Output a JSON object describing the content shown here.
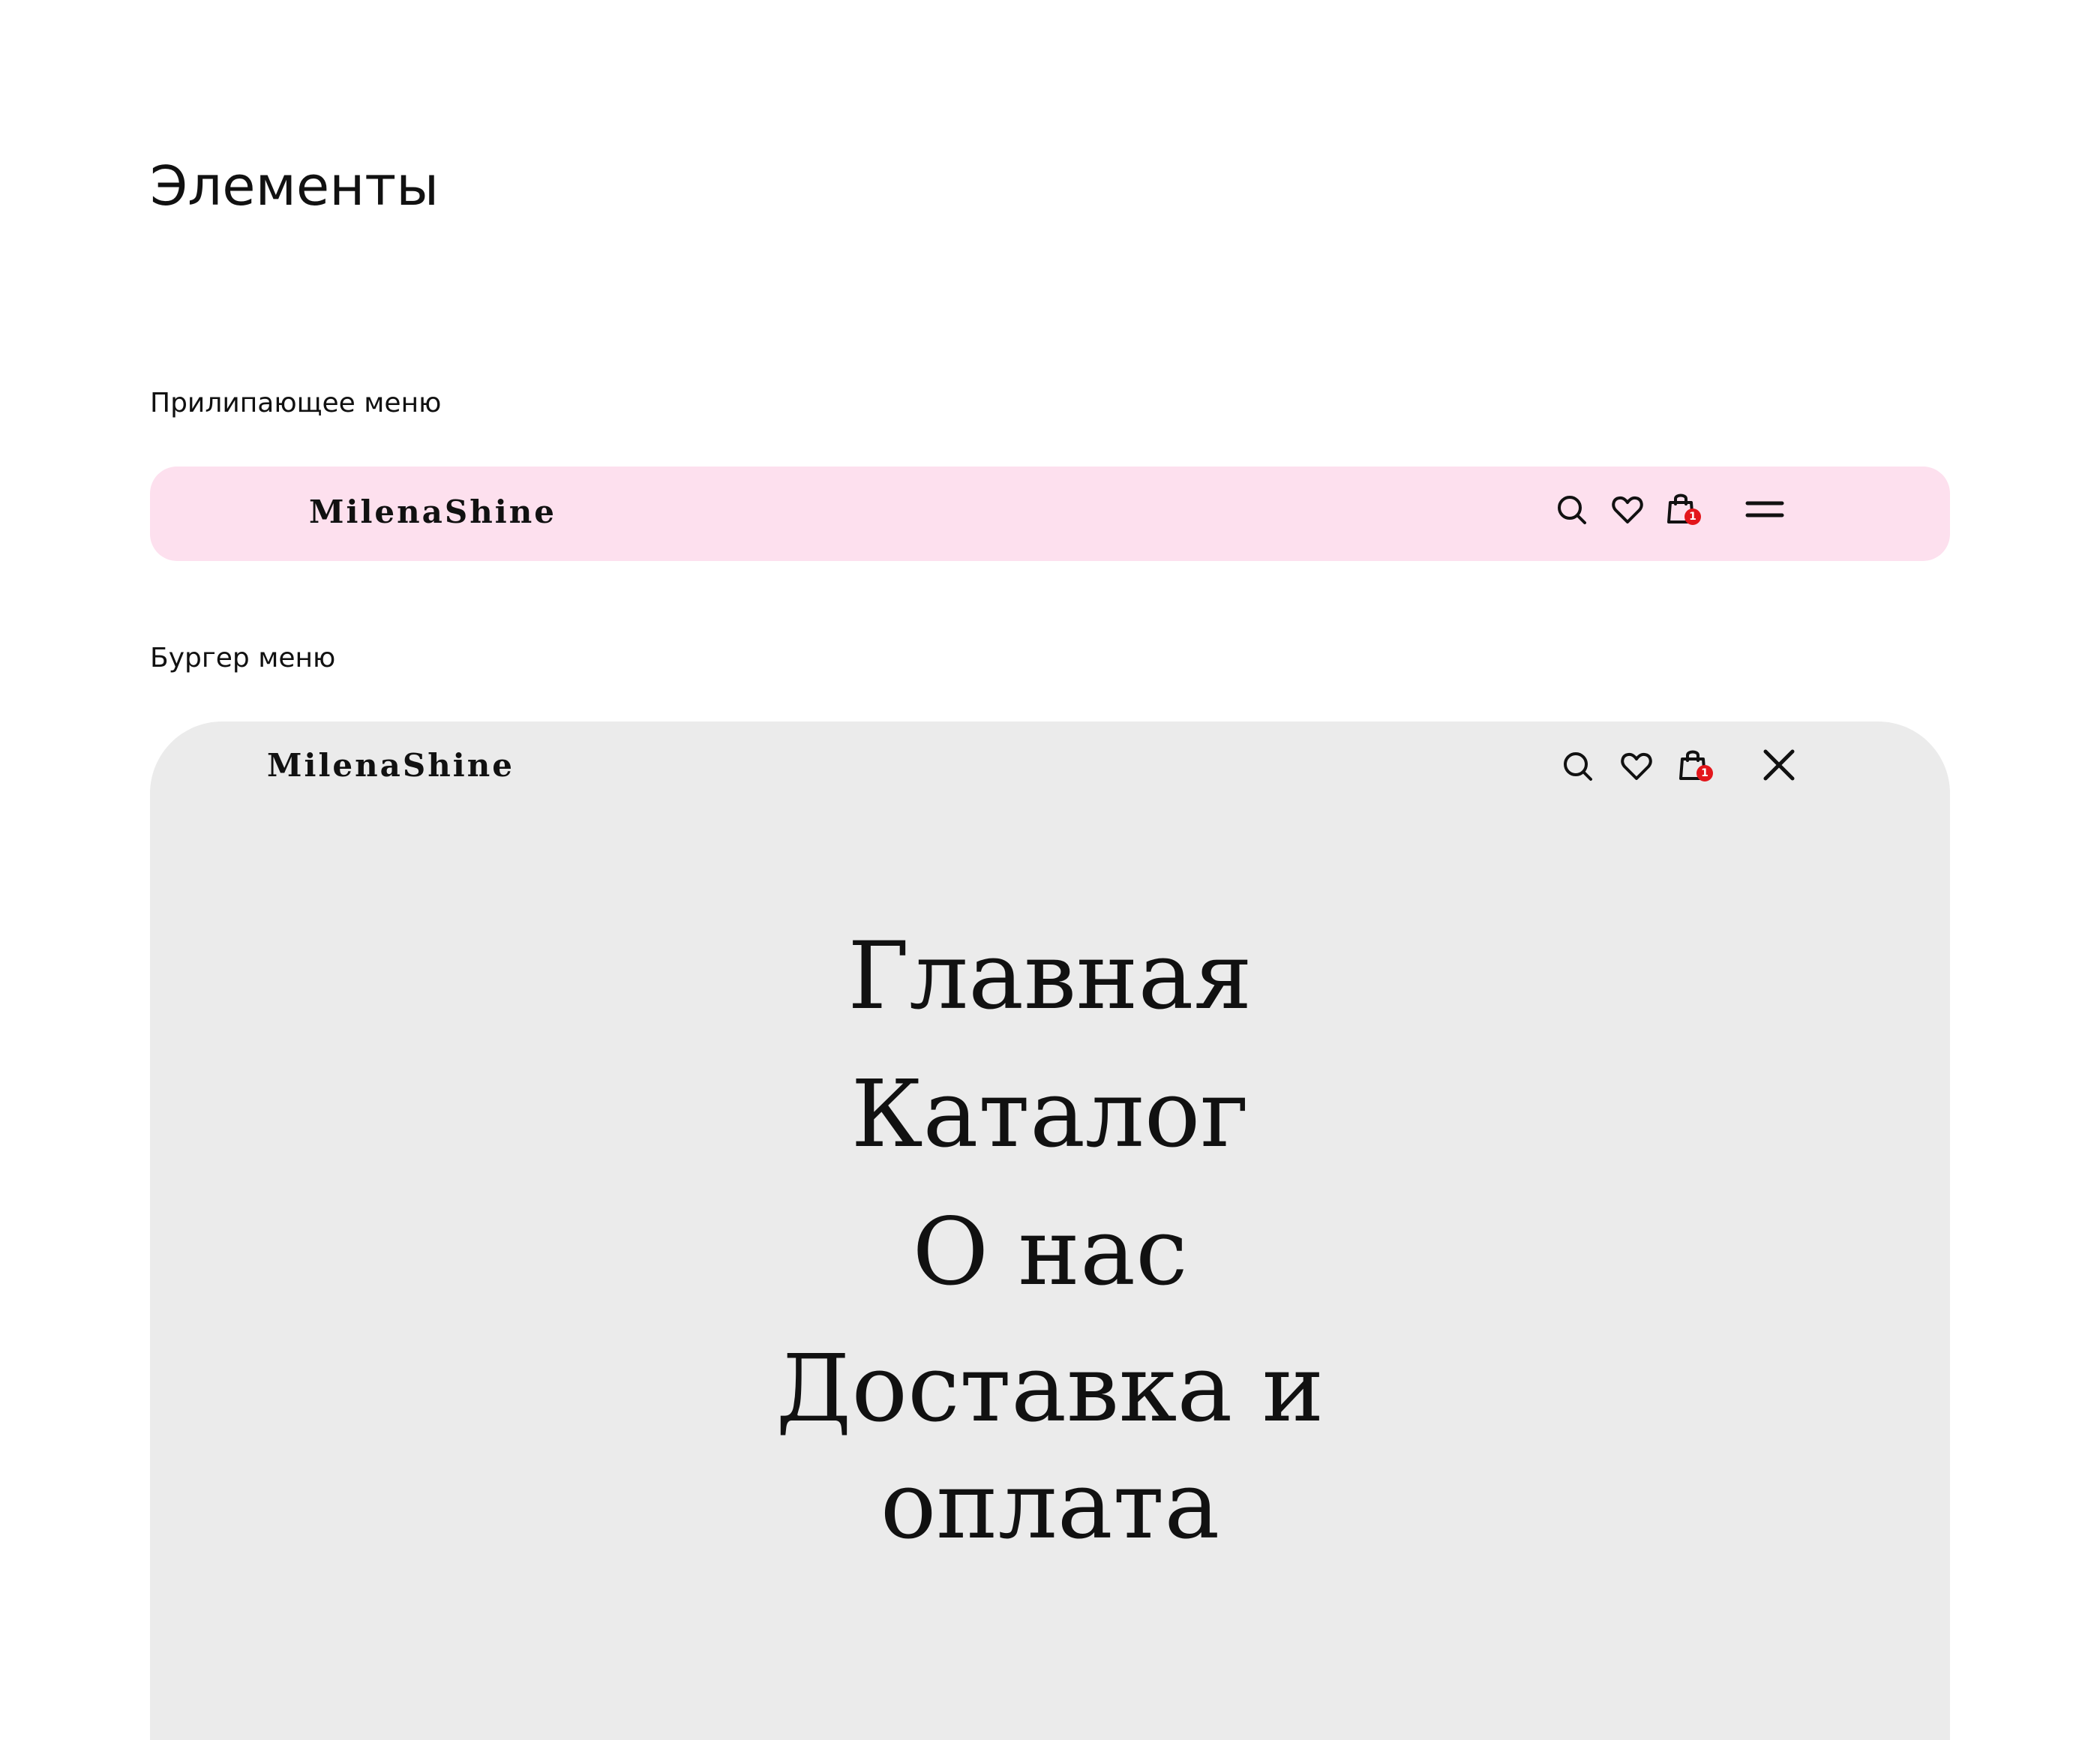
{
  "page": {
    "title": "Элементы"
  },
  "sections": {
    "sticky_label": "Прилипающее меню",
    "burger_label": "Бургер меню"
  },
  "sticky_menu": {
    "logo": "MilenaShine",
    "background": "#fde0ee",
    "icons": [
      "search-icon",
      "heart-icon",
      "shopping-bag-icon",
      "hamburger-menu-icon"
    ],
    "cart_count": "1"
  },
  "burger_menu": {
    "logo": "MilenaShine",
    "background": "#ebebeb",
    "icons": [
      "search-icon",
      "heart-icon",
      "shopping-bag-icon",
      "close-icon"
    ],
    "cart_count": "1",
    "nav": [
      {
        "label": "Главная"
      },
      {
        "label": "Каталог"
      },
      {
        "label": "О нас"
      },
      {
        "label": "Доставка и оплата"
      }
    ]
  },
  "colors": {
    "badge": "#e3161b",
    "text": "#111111"
  }
}
